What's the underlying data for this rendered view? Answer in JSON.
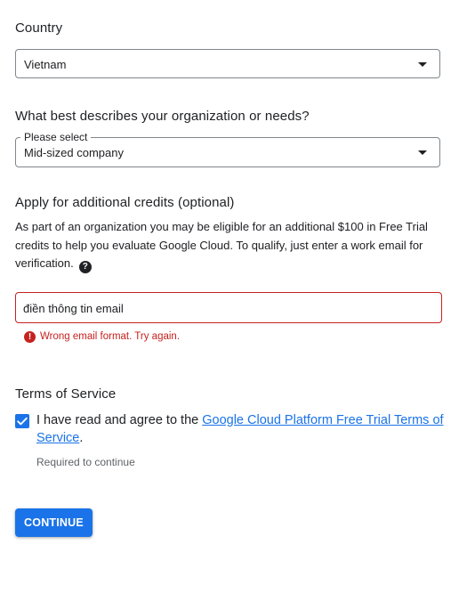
{
  "country": {
    "label": "Country",
    "selected": "Vietnam"
  },
  "organization": {
    "label": "What best describes your organization or needs?",
    "floating_label": "Please select",
    "selected": "Mid-sized company"
  },
  "credits": {
    "title": "Apply for additional credits (optional)",
    "description": "As part of an organization you may be eligible for an additional $100 in Free Trial credits to help you evaluate Google Cloud. To qualify, just enter a work email for verification.",
    "help_glyph": "?",
    "email_value": "điền thông tin email",
    "error_glyph": "!",
    "error_message": "Wrong email format. Try again."
  },
  "terms": {
    "title": "Terms of Service",
    "checked": true,
    "agree_text": "I have read and agree to the ",
    "link_text": "Google Cloud Platform Free Trial Terms of Service",
    "after_link": ".",
    "hint": "Required to continue"
  },
  "actions": {
    "continue_label": "CONTINUE"
  },
  "colors": {
    "primary": "#1a73e8",
    "error": "#c5221f",
    "text": "#202124",
    "secondary_text": "#5f6368",
    "border": "#80868b"
  }
}
